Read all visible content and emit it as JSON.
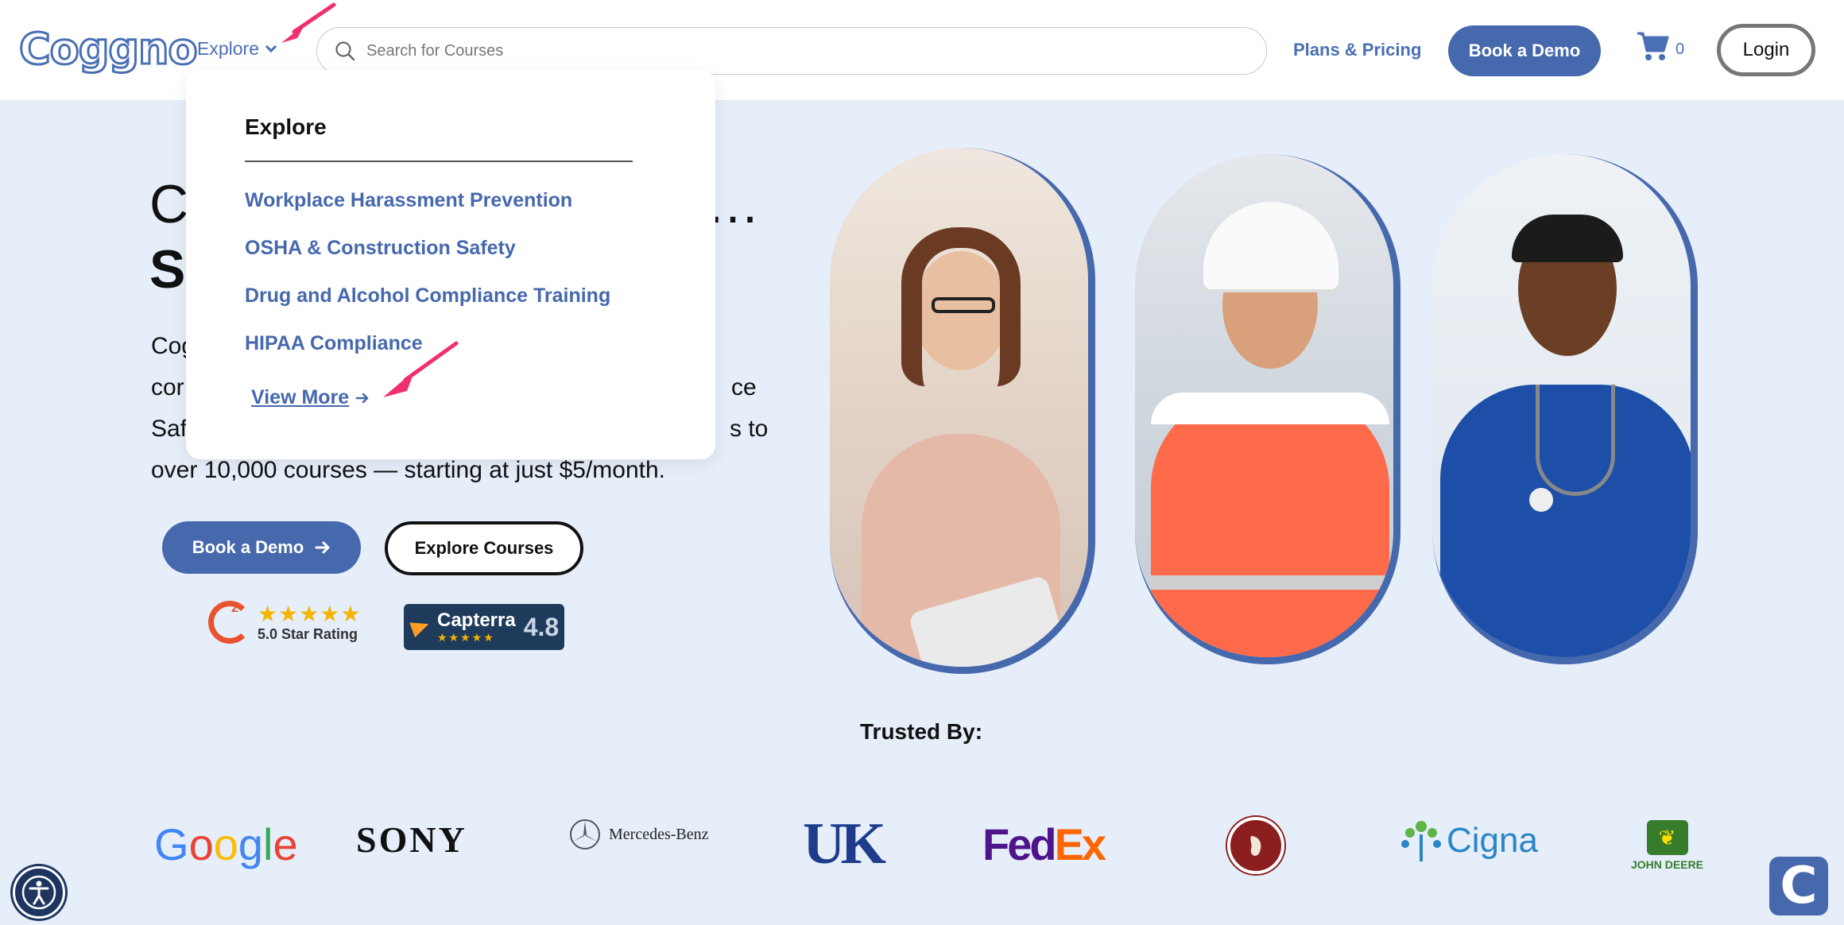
{
  "header": {
    "logo": "Coggno",
    "explore_label": "Explore",
    "search_placeholder": "Search for Courses",
    "plans_label": "Plans & Pricing",
    "book_demo_label": "Book a Demo",
    "cart_count": "0",
    "login_label": "Login"
  },
  "dropdown": {
    "title": "Explore",
    "items": [
      "Workplace Harassment Prevention",
      "OSHA & Construction Safety",
      "Drug and Alcohol Compliance Training",
      "HIPAA Compliance"
    ],
    "view_more": "View More"
  },
  "hero": {
    "title_line1": "C",
    "title_line2": "S",
    "title_right": "…",
    "para_line1": "Cog",
    "para_line2": "cor",
    "para_line2_right": "ce",
    "para_line3": "Saf",
    "para_line3_right": "s to",
    "para_line4": "over 10,000 courses — starting at just $5/month.",
    "book_demo_label": "Book a Demo",
    "explore_courses_label": "Explore Courses",
    "g2_label": "5.0 Star Rating",
    "g2_stars": "★★★★★",
    "capterra_name": "Capterra",
    "capterra_stars": "★★★★★",
    "capterra_score": "4.8"
  },
  "trusted": {
    "label": "Trusted By:",
    "logos": [
      "Google",
      "SONY",
      "Mercedes-Benz",
      "UK",
      "FedEx",
      "Chipotle",
      "Cigna",
      "John Deere"
    ],
    "google_letters": [
      "G",
      "o",
      "o",
      "g",
      "l",
      "e"
    ],
    "fedex_fed": "Fed",
    "fedex_ex": "Ex",
    "deere_text": "JOHN DEERE",
    "cigna_text": "Cigna"
  },
  "colors": {
    "brand": "#4668ad",
    "hero_bg": "#e6eefa",
    "annotation_arrow": "#f0306e"
  },
  "chat_label": "C"
}
